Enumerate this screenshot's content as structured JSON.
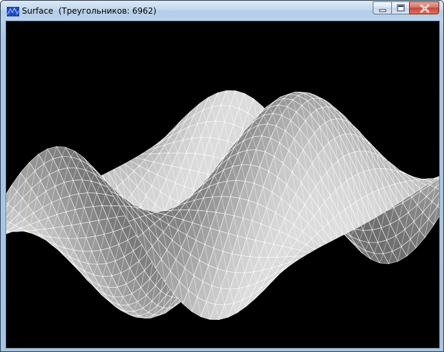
{
  "window": {
    "title": "Surface  (Треугольников: 6962)"
  },
  "icons": {
    "app": "app-icon",
    "minimize": "minimize-icon",
    "maximize": "maximize-icon",
    "close": "close-icon"
  },
  "colors": {
    "viewport_background": "#000000",
    "mesh": "#ffffff",
    "close_button": "#c7453a",
    "titlebar": "#c2d8ee"
  }
}
